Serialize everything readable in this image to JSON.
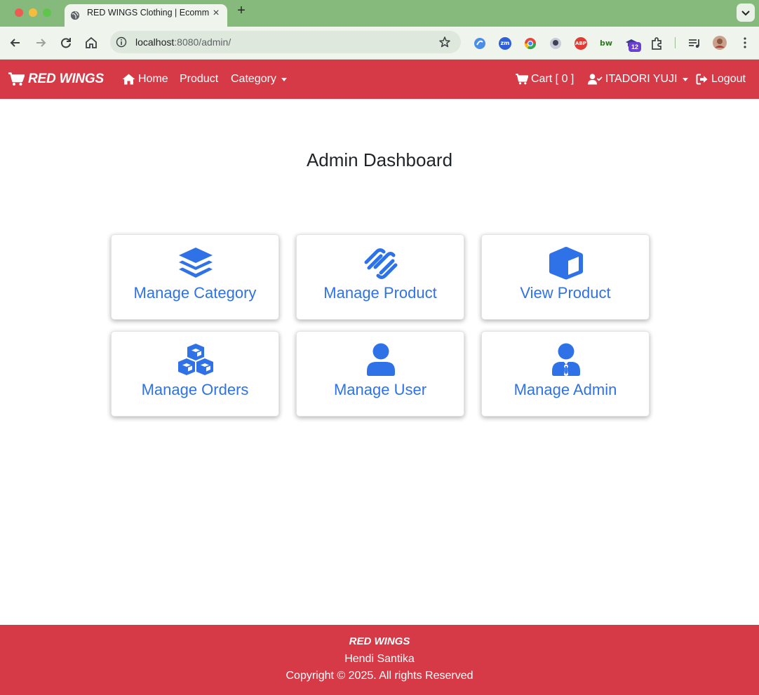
{
  "browser": {
    "tab_title": "RED WINGS Clothing | Ecommerce",
    "url_host": "localhost",
    "url_rest": ":8080/admin/",
    "extension_badge": "12",
    "extensions": [
      "zm",
      "ABP",
      "bw"
    ]
  },
  "navbar": {
    "brand": "RED WINGS",
    "home": "Home",
    "product": "Product",
    "category": "Category",
    "cart": "Cart [ 0 ]",
    "user": "ITADORI YUJI",
    "logout": "Logout"
  },
  "main": {
    "title": "Admin Dashboard",
    "cards": [
      {
        "label": "Manage Category",
        "icon": "layers-icon"
      },
      {
        "label": "Manage Product",
        "icon": "squarespace-icon"
      },
      {
        "label": "View Product",
        "icon": "box-icon"
      },
      {
        "label": "Manage Orders",
        "icon": "cubes-icon"
      },
      {
        "label": "Manage User",
        "icon": "user-icon"
      },
      {
        "label": "Manage Admin",
        "icon": "user-tie-icon"
      }
    ]
  },
  "footer": {
    "brand": "RED WINGS",
    "author": "Hendi Santika",
    "copyright": "Copyright © 2025. All rights Reserved"
  },
  "colors": {
    "brand_red": "#d63a47",
    "accent_blue": "#2f72e8",
    "chrome_green": "#86b97c"
  }
}
